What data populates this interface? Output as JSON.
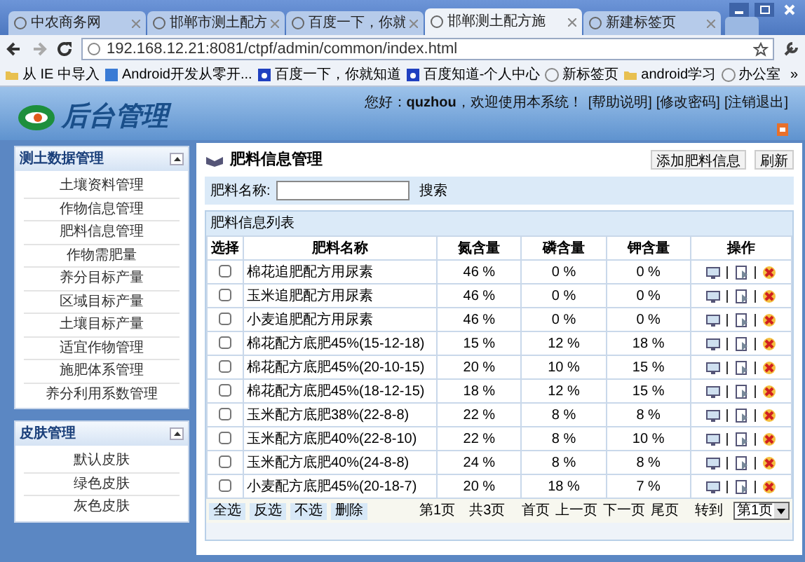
{
  "browser": {
    "tabs": [
      {
        "label": "中农商务网",
        "selected": false
      },
      {
        "label": "邯郸市测土配方",
        "selected": false
      },
      {
        "label": "百度一下，你就",
        "selected": false
      },
      {
        "label": "邯郸测土配方施",
        "selected": true
      },
      {
        "label": "新建标签页",
        "selected": false
      }
    ],
    "address": "192.168.12.21:8081/ctpf/admin/common/index.html",
    "bookmarks": [
      {
        "label": "从 IE 中导入",
        "kind": "folder"
      },
      {
        "label": "Android开发从零开...",
        "kind": "page"
      },
      {
        "label": "百度一下，你就知道",
        "kind": "paw"
      },
      {
        "label": "百度知道-个人中心",
        "kind": "paw"
      },
      {
        "label": "新标签页",
        "kind": "globe"
      },
      {
        "label": "android学习",
        "kind": "folder"
      },
      {
        "label": "办公室",
        "kind": "globe"
      }
    ],
    "more": "»"
  },
  "header": {
    "logo": "后台管理",
    "greeting": "您好：",
    "user": "quzhou",
    "welcome": "，欢迎使用本系统！",
    "links": [
      "[帮助说明]",
      "[修改密码]",
      "[注销退出]"
    ]
  },
  "sidebar": [
    {
      "title": "测土数据管理",
      "items": [
        "土壤资料管理",
        "作物信息管理",
        "肥料信息管理",
        "作物需肥量",
        "养分目标产量",
        "区域目标产量",
        "土壤目标产量",
        "适宜作物管理",
        "施肥体系管理",
        "养分利用系数管理"
      ]
    },
    {
      "title": "皮肤管理",
      "items": [
        "默认皮肤",
        "绿色皮肤",
        "灰色皮肤"
      ]
    }
  ],
  "content": {
    "title": "肥料信息管理",
    "actions": [
      "添加肥料信息",
      "刷新"
    ],
    "search_label": "肥料名称:",
    "search_button": "搜索",
    "list_title": "肥料信息列表",
    "columns": [
      "选择",
      "肥料名称",
      "氮含量",
      "磷含量",
      "钾含量",
      "操作"
    ],
    "rows": [
      {
        "checked": false,
        "name": "棉花追肥配方用尿素",
        "n": "46 %",
        "p": "0 %",
        "k": "0 %"
      },
      {
        "checked": false,
        "name": "玉米追肥配方用尿素",
        "n": "46 %",
        "p": "0 %",
        "k": "0 %"
      },
      {
        "checked": false,
        "name": "小麦追肥配方用尿素",
        "n": "46 %",
        "p": "0 %",
        "k": "0 %"
      },
      {
        "checked": false,
        "name": "棉花配方底肥45%(15-12-18)",
        "n": "15 %",
        "p": "12 %",
        "k": "18 %"
      },
      {
        "checked": false,
        "name": "棉花配方底肥45%(20-10-15)",
        "n": "20 %",
        "p": "10 %",
        "k": "15 %"
      },
      {
        "checked": false,
        "name": "棉花配方底肥45%(18-12-15)",
        "n": "18 %",
        "p": "12 %",
        "k": "15 %"
      },
      {
        "checked": false,
        "name": "玉米配方底肥38%(22-8-8)",
        "n": "22 %",
        "p": "8 %",
        "k": "8 %"
      },
      {
        "checked": false,
        "name": "玉米配方底肥40%(22-8-10)",
        "n": "22 %",
        "p": "8 %",
        "k": "10 %"
      },
      {
        "checked": false,
        "name": "玉米配方底肥40%(24-8-8)",
        "n": "24 %",
        "p": "8 %",
        "k": "8 %"
      },
      {
        "checked": false,
        "name": "小麦配方底肥45%(20-18-7)",
        "n": "20 %",
        "p": "18 %",
        "k": "7 %"
      }
    ],
    "bulk_buttons": [
      "全选",
      "反选",
      "不选",
      "删除"
    ],
    "pager": {
      "current": "第1页",
      "total": "共3页",
      "links": [
        "首页",
        "上一页",
        "下一页",
        "尾页"
      ],
      "goto": "转到",
      "select": "第1页"
    }
  }
}
